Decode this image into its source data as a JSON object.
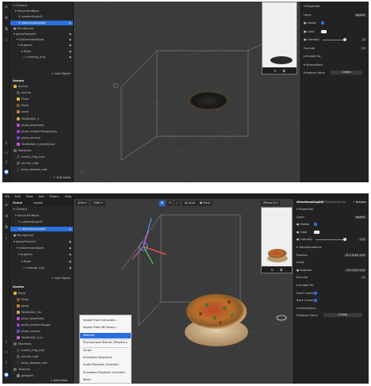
{
  "shotA": {
    "scene_tree": [
      {
        "label": "Camera",
        "prefix": "▾",
        "sel": false,
        "eye": false
      },
      {
        "label": "Visual Emitters",
        "prefix": "▾",
        "sel": false,
        "eye": false
      },
      {
        "label": "ambientLight0",
        "prefix": "☀",
        "sel": false,
        "eye": false
      },
      {
        "label": "directionalLight0",
        "prefix": "☀",
        "sel": true,
        "eye": true
      },
      {
        "label": "Microphone",
        "prefix": "●",
        "sel": false,
        "eye": false
      },
      {
        "label": "planeTracker0",
        "prefix": "▾",
        "sel": false,
        "eye": true
      },
      {
        "label": "Quickrenderblock",
        "prefix": "▾",
        "sel": false,
        "eye": true
      },
      {
        "label": "Augmen",
        "prefix": "▾",
        "sel": false,
        "eye": true
      },
      {
        "label": "Pizza",
        "prefix": "▾",
        "sel": false,
        "eye": true
      },
      {
        "label": "nonmap_ring",
        "prefix": "○",
        "sel": false,
        "eye": true
      }
    ],
    "add_object": "+ Add Object",
    "assets_title": "Assets",
    "assets": [
      {
        "label": "anchor",
        "color": "#e0b830"
      },
      {
        "label": "anchor",
        "color": "#555555"
      },
      {
        "label": "Pizza",
        "color": "#e0b830"
      },
      {
        "label": "Pizza",
        "color": "#7a5a3a"
      },
      {
        "label": "pizza",
        "color": "#c08040"
      },
      {
        "label": "TarsBuild1_4",
        "color": "#d4a25a"
      },
      {
        "label": "pizza_baseCake",
        "color": "#b04ad0"
      },
      {
        "label": "pizza_metallicRoughness",
        "color": "#9a3ad0"
      },
      {
        "label": "pizza_normal",
        "color": "#6a4ad0"
      },
      {
        "label": "TarsBuild1_4_baseColor",
        "color": "#c05ad0"
      },
      {
        "label": "Materials",
        "color": "#666666"
      },
      {
        "label": "mamo_ring_mat",
        "color": "#444444"
      },
      {
        "label": "anchor_mat",
        "color": "#555555"
      },
      {
        "label": "drop_shadow_mat",
        "color": "#333333"
      }
    ],
    "add_asset": "+ Add Asset",
    "properties": [
      {
        "label": "▾ Properties",
        "val": ""
      },
      {
        "label": "Layer",
        "val": "layer0"
      },
      {
        "label": "● Visible",
        "val": "chk"
      },
      {
        "label": "● Color",
        "val": "swatch"
      },
      {
        "label": "● Intensity",
        "val": "1"
      },
      {
        "label": "Exclude",
        "val": "+"
      },
      {
        "label": "▸ Enable For",
        "val": ""
      },
      {
        "label": "▾ Interactions",
        "val": ""
      },
      {
        "label": "Producer Patch",
        "val": "Create"
      }
    ]
  },
  "shotB": {
    "menu": [
      "File",
      "Edit",
      "View",
      "Add",
      "Project",
      "Help"
    ],
    "tabs": [
      "Scene",
      "Layers"
    ],
    "scene_tree": [
      {
        "label": "Camera",
        "prefix": "▾",
        "sel": false,
        "eye": false
      },
      {
        "label": "Visual Emitters",
        "prefix": "▾",
        "sel": false,
        "eye": false
      },
      {
        "label": "ambientLight0",
        "prefix": "☀",
        "sel": false,
        "eye": false
      },
      {
        "label": "directionalLight0",
        "prefix": "☀",
        "sel": true,
        "eye": true
      },
      {
        "label": "Microphone",
        "prefix": "●",
        "sel": false,
        "eye": false
      },
      {
        "label": "planeTracker0",
        "prefix": "▾",
        "sel": false,
        "eye": true
      },
      {
        "label": "Quickrenderblock",
        "prefix": "▾",
        "sel": false,
        "eye": true
      },
      {
        "label": "Augmen",
        "prefix": "▾",
        "sel": false,
        "eye": true
      },
      {
        "label": "Pizza",
        "prefix": "▾",
        "sel": false,
        "eye": true
      },
      {
        "label": "mamap_ring",
        "prefix": "○",
        "sel": false,
        "eye": true
      }
    ],
    "add_object": "+ Add Object",
    "assets_title": "Assets",
    "assets": [
      {
        "label": "Pizza",
        "color": "#e0b830"
      },
      {
        "label": "Pizza",
        "color": "#7a5a3a"
      },
      {
        "label": "pizza",
        "color": "#c08040"
      },
      {
        "label": "TarsBuild1_4b",
        "color": "#d4a25a"
      },
      {
        "label": "pizza_baseCake",
        "color": "#b04ad0"
      },
      {
        "label": "pizza_metallicRough",
        "color": "#9a3ad0"
      },
      {
        "label": "pizza_normal",
        "color": "#6a4ad0"
      },
      {
        "label": "TarsBuild1_4_b",
        "color": "#c05ad0"
      },
      {
        "label": "Materials",
        "color": "#666666"
      },
      {
        "label": "mamo_ring_mat",
        "color": "#444444"
      },
      {
        "label": "anchor_mat",
        "color": "#555555"
      },
      {
        "label": "drop_shadow_mat",
        "color": "#333333"
      },
      {
        "label": "Textures",
        "color": "#666666"
      },
      {
        "label": "garage0",
        "color": "#8a7a6a"
      }
    ],
    "add_asset": "+ Add Asset",
    "toolbar": {
      "view": "View ▾",
      "filter": "Filter ▾",
      "local": "Local",
      "pivot": "Pivot",
      "device": "iPhone 8 ▾"
    },
    "right_title": "directionalLight0",
    "right_subtitle": "Directional Lig",
    "right_action": "⚡ Actions",
    "properties": [
      {
        "label": "▾ Properties",
        "val": ""
      },
      {
        "label": "Layer",
        "val": "layer0"
      },
      {
        "label": "● Visible",
        "val": "chk"
      },
      {
        "label": "● Color",
        "val": "swatch"
      },
      {
        "label": "● Intensity",
        "val": "1.0"
      },
      {
        "label": "▾ Transformations",
        "val": ""
      },
      {
        "label": "Position",
        "val": "-0.1  0.44  -0.0"
      },
      {
        "label": "Scale",
        "val": ""
      },
      {
        "label": "● Rotation",
        "val": "1.0  -93.1  0.0"
      },
      {
        "label": "Exclude",
        "val": "+"
      },
      {
        "label": "▾ Enable For",
        "val": ""
      },
      {
        "label": "Front Camera",
        "val": "chk"
      },
      {
        "label": "Back Camera",
        "val": "chk"
      },
      {
        "label": "▾ Interactions",
        "val": ""
      },
      {
        "label": "Producer Patch",
        "val": "Create"
      }
    ],
    "context_menu": [
      {
        "label": "Import From Computer...",
        "hl": false
      },
      {
        "label": "Import From AR Library...",
        "hl": false
      },
      {
        "label": "Material",
        "hl": true
      },
      {
        "label": "Environment Texture (Presets) ▸",
        "hl": false
      },
      {
        "label": "Script",
        "hl": false
      },
      {
        "label": "Animation Sequence",
        "hl": false
      },
      {
        "label": "Audio Playback Controller",
        "hl": false
      },
      {
        "label": "Animation Playback Controller",
        "hl": false
      },
      {
        "label": "Block",
        "hl": false
      }
    ]
  }
}
